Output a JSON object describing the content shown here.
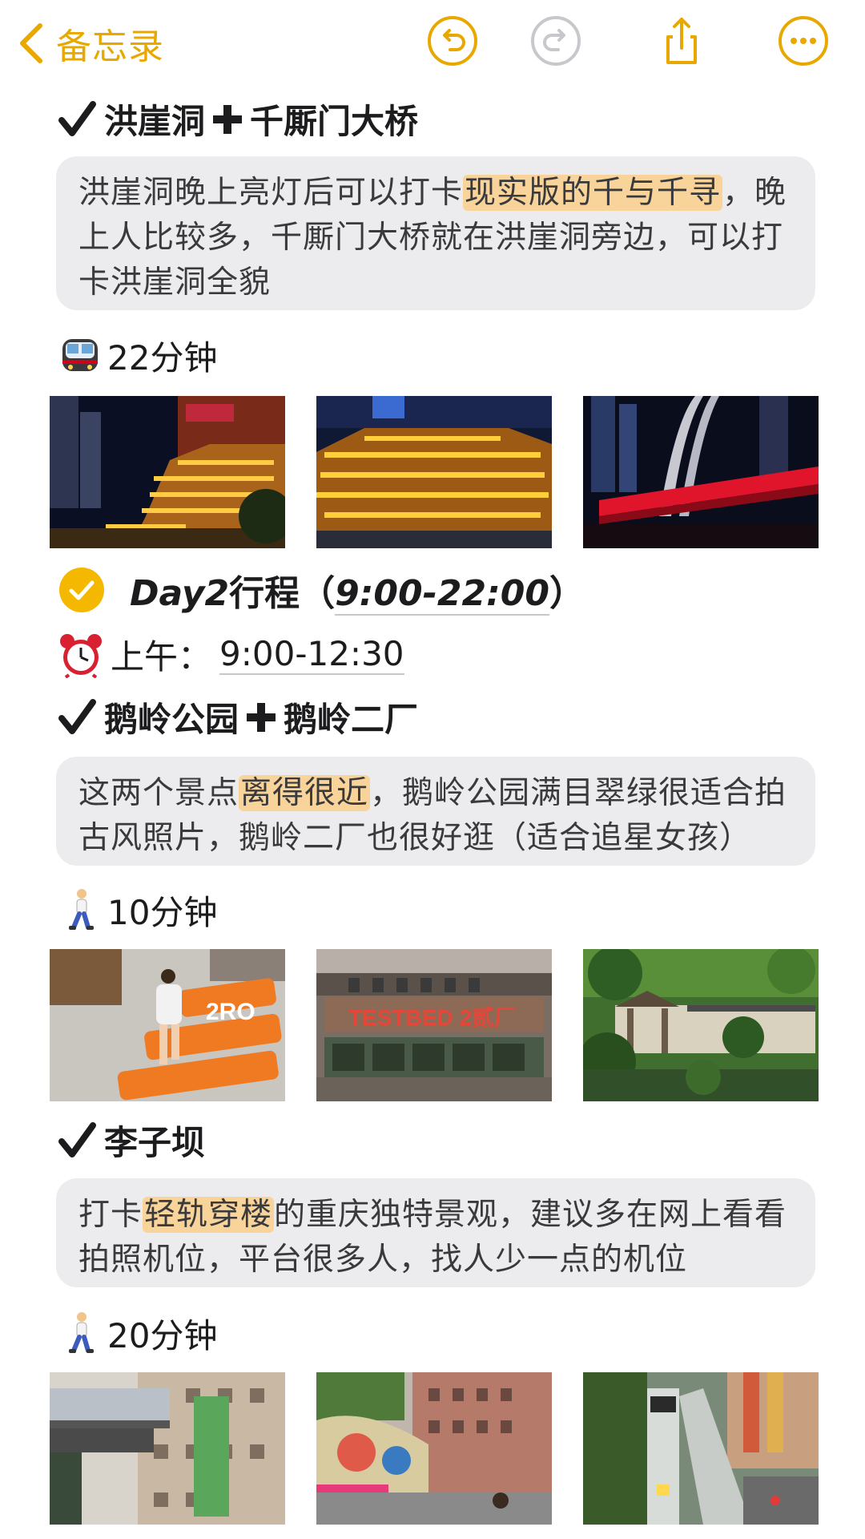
{
  "nav": {
    "back_label": "备忘录",
    "icons": [
      "back-chevron-icon",
      "undo-icon",
      "redo-icon",
      "share-icon",
      "more-icon"
    ],
    "accent_color": "#e8a800"
  },
  "sections": [
    {
      "title_a": "洪崖洞",
      "title_b": "千厮门大桥",
      "desc_pre": "洪崖洞晚上亮灯后可以打卡",
      "desc_hl": "现实版的千与千寻",
      "desc_post": "，晚上人比较多，千厮门大桥就在洪崖洞旁边，可以打卡洪崖洞全貌",
      "duration": "22分钟",
      "duration_icon": "metro-train-icon"
    },
    {
      "title_a": "鹅岭公园",
      "title_b": "鹅岭二厂",
      "desc_pre": "这两个景点",
      "desc_hl": "离得很近",
      "desc_post": "，鹅岭公园满目翠绿很适合拍古风照片，鹅岭二厂也很好逛（适合追星女孩）",
      "duration": "10分钟",
      "duration_icon": "walking-person-icon"
    },
    {
      "title_a": "李子坝",
      "desc_pre": "打卡",
      "desc_hl": "轻轨穿楼",
      "desc_post": "的重庆独特景观，建议多在网上看看拍照机位，平台很多人，找人少一点的机位",
      "duration": "20分钟",
      "duration_icon": "walking-person-icon"
    }
  ],
  "day": {
    "label": "Day2",
    "label_cn": "行程（",
    "time_range": "9:00-22:00",
    "close": "）",
    "checked": true
  },
  "morning": {
    "label": "上午：",
    "time": "9:00-12:30",
    "icon": "alarm-clock-icon"
  },
  "photo_texts": {
    "sign_testbed": "TESTBED 2贰厂",
    "sign_2ro": "2RO"
  },
  "highlight_color": "#f8d49a"
}
